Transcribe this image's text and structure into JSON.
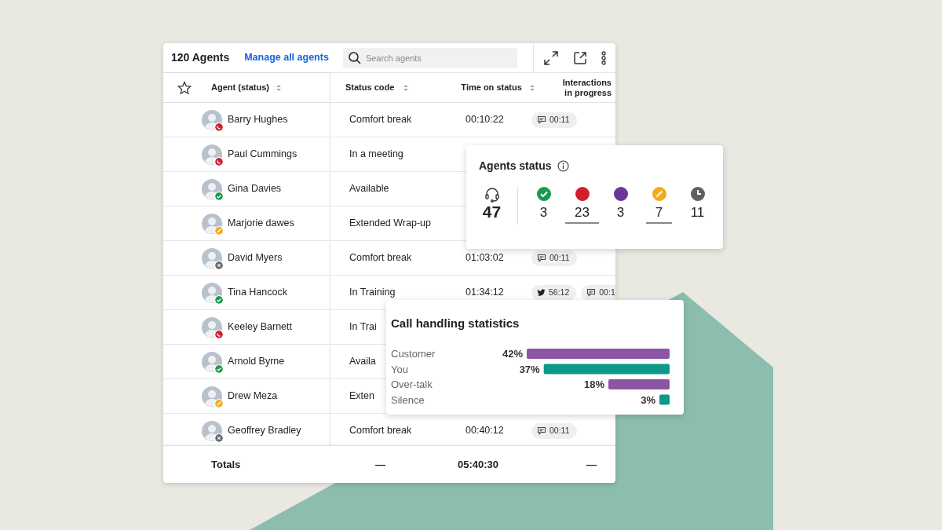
{
  "header": {
    "title": "120 Agents",
    "link": "Manage all agents",
    "search": {
      "placeholder": "Search agents"
    }
  },
  "columns": [
    "Agent (status)",
    "Status code",
    "Time on status",
    "Interactions in progress"
  ],
  "rows": [
    {
      "name": "Barry Hughes",
      "kind": "busy",
      "status_code": "Comfort break",
      "time": "00:10:22",
      "interactions": [
        {
          "kind": "chat",
          "text": "00:11"
        }
      ]
    },
    {
      "name": "Paul Cummings",
      "kind": "busy",
      "status_code": "In a meeting",
      "interactions": []
    },
    {
      "name": "Gina Davies",
      "kind": "available",
      "status_code": "Available",
      "interactions": []
    },
    {
      "name": "Marjorie dawes",
      "kind": "wrapup",
      "status_code": "Extended Wrap-up",
      "interactions": []
    },
    {
      "name": "David Myers",
      "kind": "offline",
      "status_code": "Comfort break",
      "time": "01:03:02",
      "interactions": [
        {
          "kind": "chat",
          "text": "00:11"
        }
      ]
    },
    {
      "name": "Tina Hancock",
      "kind": "available",
      "status_code": "In Training",
      "time": "01:34:12",
      "interactions": [
        {
          "kind": "bird",
          "text": "56:12"
        },
        {
          "kind": "chat",
          "text": "00:1"
        }
      ]
    },
    {
      "name": "Keeley Barnett",
      "kind": "busy",
      "status_code": "In Trai",
      "interactions": []
    },
    {
      "name": "Arnold Byrne",
      "kind": "available",
      "status_code": "Availa",
      "interactions": []
    },
    {
      "name": "Drew Meza",
      "kind": "wrapup",
      "status_code": "Exten",
      "interactions": []
    },
    {
      "name": "Geoffrey Bradley",
      "kind": "offline",
      "status_code": "Comfort break",
      "time": "00:40:12",
      "interactions": [
        {
          "kind": "chat",
          "text": "00:11"
        }
      ]
    }
  ],
  "totals": {
    "label": "Totals",
    "status_code": "—",
    "time": "05:40:30",
    "interactions": "—"
  },
  "agents_status": {
    "title": "Agents status",
    "total": "47",
    "items": [
      {
        "kind": "check",
        "color": "#1a9a50",
        "count": "3",
        "underlined": false
      },
      {
        "kind": "dot",
        "color": "#d0202f",
        "count": "23",
        "underlined": true
      },
      {
        "kind": "dot",
        "color": "#6e3599",
        "count": "3",
        "underlined": false
      },
      {
        "kind": "pencil",
        "color": "#f2ab1a",
        "count": "7",
        "underlined": true
      },
      {
        "kind": "clock",
        "color": "#5f5f5f",
        "count": "11",
        "underlined": false
      }
    ]
  },
  "call_stats": {
    "title": "Call handling statistics",
    "chart_data": {
      "type": "bar",
      "orientation": "horizontal",
      "categories": [
        "Customer",
        "You",
        "Over-talk",
        "Silence"
      ],
      "values": [
        42,
        37,
        18,
        3
      ],
      "value_labels": [
        "42%",
        "37%",
        "18%",
        "3%"
      ]
    }
  }
}
